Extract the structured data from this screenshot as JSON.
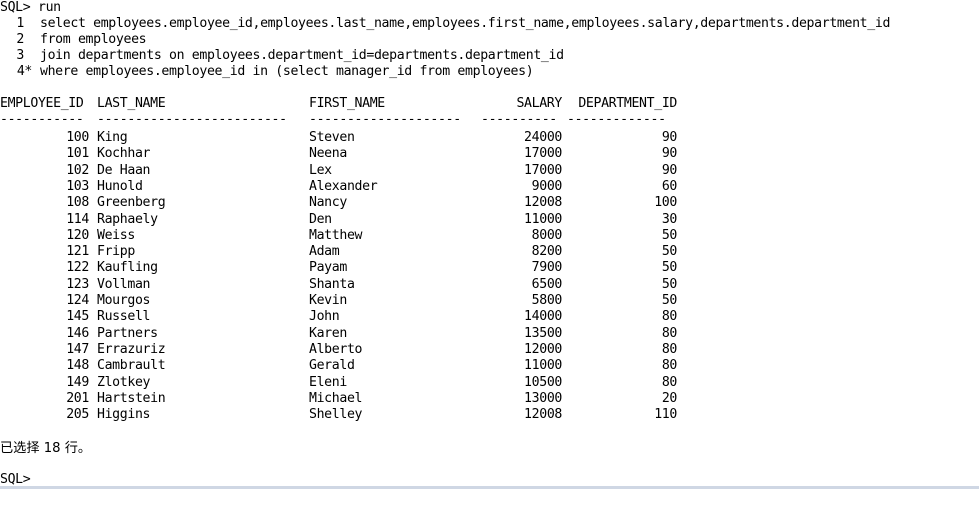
{
  "prompt": "SQL>",
  "command": "run",
  "query_lines": [
    {
      "num": "1",
      "text": "select employees.employee_id,employees.last_name,employees.first_name,employees.salary,departments.department_id"
    },
    {
      "num": "2",
      "text": "from employees"
    },
    {
      "num": "3",
      "text": "join departments on employees.department_id=departments.department_id"
    },
    {
      "num": "4*",
      "text": "where employees.employee_id in (select manager_id from employees)"
    }
  ],
  "table": {
    "headers": [
      "EMPLOYEE_ID",
      "LAST_NAME",
      "FIRST_NAME",
      "SALARY",
      "DEPARTMENT_ID"
    ],
    "separators": [
      "-----------",
      "-------------------------",
      "--------------------",
      "----------",
      "-------------"
    ],
    "rows": [
      [
        "100",
        "King",
        "Steven",
        "24000",
        "90"
      ],
      [
        "101",
        "Kochhar",
        "Neena",
        "17000",
        "90"
      ],
      [
        "102",
        "De Haan",
        "Lex",
        "17000",
        "90"
      ],
      [
        "103",
        "Hunold",
        "Alexander",
        "9000",
        "60"
      ],
      [
        "108",
        "Greenberg",
        "Nancy",
        "12008",
        "100"
      ],
      [
        "114",
        "Raphaely",
        "Den",
        "11000",
        "30"
      ],
      [
        "120",
        "Weiss",
        "Matthew",
        "8000",
        "50"
      ],
      [
        "121",
        "Fripp",
        "Adam",
        "8200",
        "50"
      ],
      [
        "122",
        "Kaufling",
        "Payam",
        "7900",
        "50"
      ],
      [
        "123",
        "Vollman",
        "Shanta",
        "6500",
        "50"
      ],
      [
        "124",
        "Mourgos",
        "Kevin",
        "5800",
        "50"
      ],
      [
        "145",
        "Russell",
        "John",
        "14000",
        "80"
      ],
      [
        "146",
        "Partners",
        "Karen",
        "13500",
        "80"
      ],
      [
        "147",
        "Errazuriz",
        "Alberto",
        "12000",
        "80"
      ],
      [
        "148",
        "Cambrault",
        "Gerald",
        "11000",
        "80"
      ],
      [
        "149",
        "Zlotkey",
        "Eleni",
        "10500",
        "80"
      ],
      [
        "201",
        "Hartstein",
        "Michael",
        "13000",
        "20"
      ],
      [
        "205",
        "Higgins",
        "Shelley",
        "12008",
        "110"
      ]
    ]
  },
  "result_message": "已选择 18 行。",
  "final_prompt": "SQL>"
}
